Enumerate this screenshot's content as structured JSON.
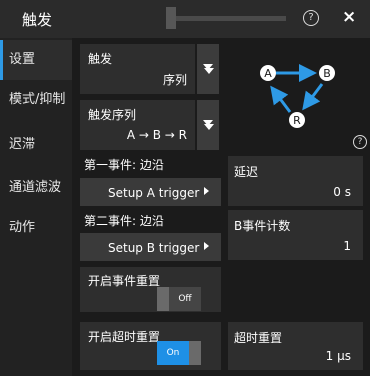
{
  "window": {
    "title": "触发",
    "help_icon": "?",
    "close_icon": "×"
  },
  "sidebar": {
    "items": [
      {
        "label": "设置"
      },
      {
        "label": "模式/抑制"
      },
      {
        "label": "迟滞"
      },
      {
        "label": "通道滤波"
      },
      {
        "label": "动作"
      }
    ]
  },
  "trigger": {
    "label": "触发",
    "value": "序列"
  },
  "sequence": {
    "label": "触发序列",
    "value": "A → B → R"
  },
  "diagram": {
    "node_a": "A",
    "node_b": "B",
    "node_r": "R",
    "help_icon": "?"
  },
  "first_event": {
    "label": "第一事件: 边沿",
    "button": "Setup A trigger"
  },
  "second_event": {
    "label": "第二事件: 边沿",
    "button": "Setup B trigger"
  },
  "delay": {
    "label": "延迟",
    "value": "0 s"
  },
  "b_count": {
    "label": "B事件计数",
    "value": "1"
  },
  "event_reset": {
    "label": "开启事件重置",
    "state": "Off"
  },
  "timeout_toggle": {
    "label": "开启超时重置",
    "state": "On"
  },
  "timeout_reset": {
    "label": "超时重置",
    "value": "1 µs"
  },
  "colors": {
    "accent": "#2e9ae6",
    "toggle_on": "#1e90e6",
    "background": "#1b1b1b"
  }
}
